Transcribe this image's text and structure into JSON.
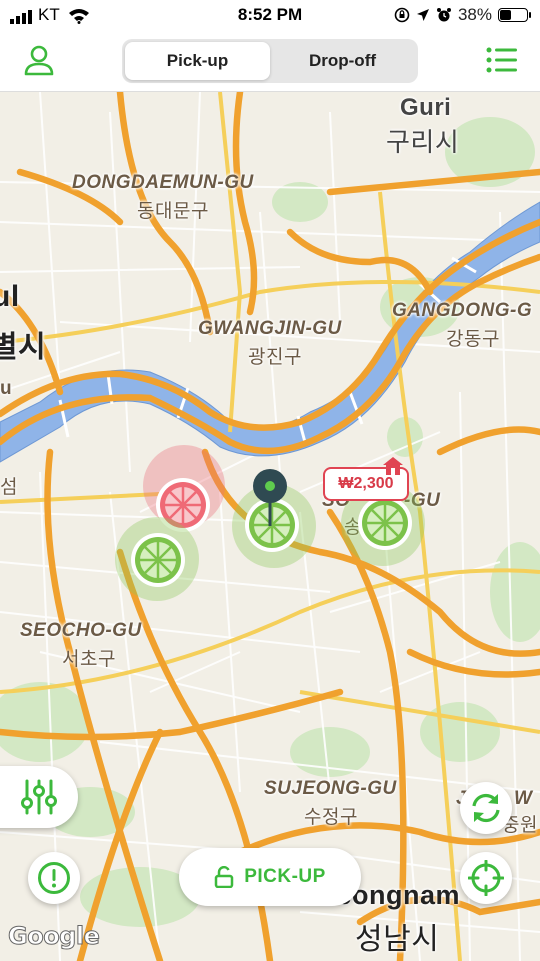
{
  "status_bar": {
    "carrier": "KT",
    "time": "8:52 PM",
    "battery": "38%",
    "battery_level": 0.38
  },
  "nav": {
    "tabs": [
      {
        "label": "Pick-up",
        "active": true
      },
      {
        "label": "Drop-off",
        "active": false
      }
    ]
  },
  "map": {
    "labels": {
      "guri_en": "Guri",
      "guri_ko": "구리시",
      "dongdaemun_en": "DONGDAEMUN-GU",
      "dongdaemun_ko": "동대문구",
      "gwangjin_en": "GWANGJIN-GU",
      "gwangjin_ko": "광진구",
      "gangdong_en": "GANGDONG-G",
      "gangdong_ko": "강동구",
      "seoul_partial_1": "ul",
      "seoul_partial_2": "별시",
      "west_u": "u",
      "west_seom": "섬",
      "songpa_en": "SO",
      "songpa_en_tail": "-GU",
      "songpa_ko": "송",
      "seocho_en": "SEOCHO-GU",
      "seocho_ko": "서초구",
      "sujeong_en": "SUJEONG-GU",
      "sujeong_ko": "수정구",
      "jungwon_partial_en": "J",
      "jungwon_partial_en2": "W",
      "jungwon_partial_ko": "중원",
      "seongnam_en": "Seongnam",
      "seongnam_ko": "성남시"
    },
    "price_tag": "₩2,300",
    "brand_color": "#3cb93c",
    "alert_color": "#e04452"
  },
  "buttons": {
    "pickup": "PICK-UP"
  },
  "google": "Google"
}
